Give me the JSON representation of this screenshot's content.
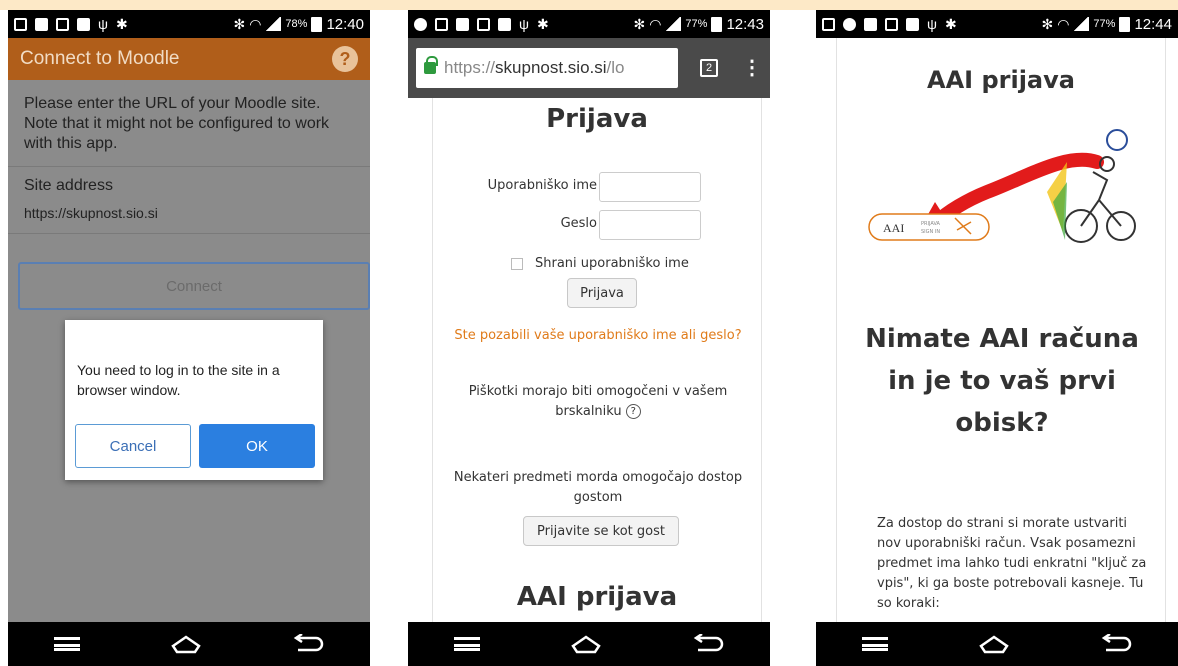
{
  "phone1": {
    "status": {
      "battery": "78%",
      "time": "12:40"
    },
    "appbar": {
      "title": "Connect to Moodle",
      "help": "?"
    },
    "intro": "Please enter the URL of your Moodle site. Note that it might not be configured to work with this app.",
    "site_label": "Site address",
    "site_value": "https://skupnost.sio.si",
    "connect_label": "Connect",
    "dialog": {
      "message": "You need to log in to the site in a browser window.",
      "cancel": "Cancel",
      "ok": "OK"
    }
  },
  "phone2": {
    "status": {
      "battery": "77%",
      "time": "12:43"
    },
    "url": {
      "scheme": "https://",
      "host": "skupnost.sio.si",
      "rest": "/lo",
      "tab_count": "2"
    },
    "heading": "Prijava",
    "username_label": "Uporabniško ime",
    "password_label": "Geslo",
    "remember_label": "Shrani uporabniško ime",
    "login_button": "Prijava",
    "forgot_link": "Ste pozabili vaše uporabniško ime ali geslo?",
    "cookies_text": "Piškotki morajo biti omogočeni v vašem brskalniku",
    "guest_text": "Nekateri predmeti morda omogočajo dostop gostom",
    "guest_button": "Prijavite se kot gost",
    "aai_heading": "AAI prijava"
  },
  "phone3": {
    "status": {
      "battery": "77%",
      "time": "12:44"
    },
    "heading": "AAI prijava",
    "badge": {
      "logo": "AAI",
      "sub1": "PRIJAVA",
      "sub2": "SIGN IN"
    },
    "subheading": "Nimate AAI računa in je to vaš prvi obisk?",
    "paragraph": "Za dostop do strani si morate ustvariti nov uporabniški račun. Vsak posamezni predmet ima lahko tudi enkratni \"ključ za vpis\", ki ga boste potrebovali kasneje. Tu so koraki:"
  },
  "colors": {
    "moodle_orange": "#b05e1a",
    "ok_blue": "#2b7fe0",
    "link_orange": "#e07b1a",
    "lock_green": "#2e9a3e"
  },
  "icons": {
    "nav": [
      "menu-icon",
      "home-icon",
      "back-icon"
    ],
    "status": [
      "image-icon",
      "sim-icon",
      "usb-icon",
      "bug-icon",
      "wifi-icon",
      "signal-icon",
      "battery-icon"
    ]
  }
}
